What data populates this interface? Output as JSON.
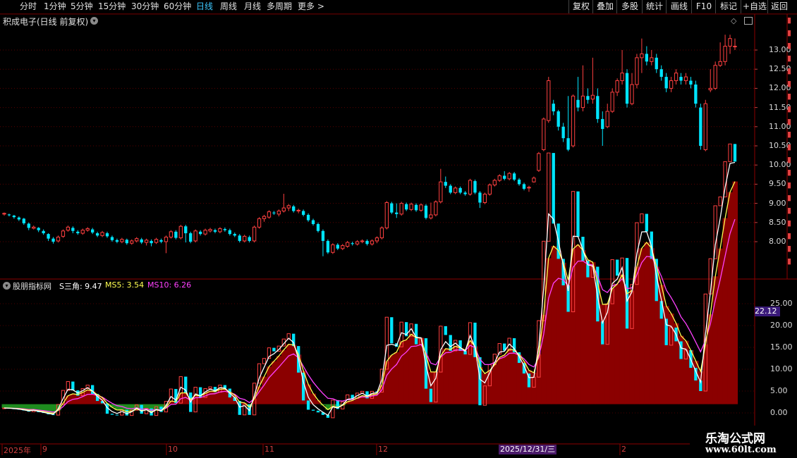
{
  "toolbar": {
    "left": [
      "分时",
      "1分钟",
      "5分钟",
      "15分钟",
      "30分钟",
      "60分钟",
      "日线",
      "周线",
      "月线",
      "多周期",
      "更多 >"
    ],
    "active": "日线",
    "right": [
      "复权",
      "叠加",
      "多股",
      "统计",
      "画线",
      "F10",
      "标记",
      "+自选",
      "返回"
    ]
  },
  "main": {
    "title": "积成电子(日线 前复权)",
    "y_labels": [
      "13.00",
      "12.50",
      "12.00",
      "11.50",
      "11.00",
      "10.50",
      "10.00",
      "9.50",
      "9.00",
      "8.50",
      "8.00"
    ]
  },
  "indicator": {
    "name": "股朋指标网",
    "s_label": "S三角: 9.47",
    "ms5_label": "MS5: 3.54",
    "ms10_label": "MS10: 6.26",
    "current_value": "22.12",
    "y_labels": [
      "25.00",
      "20.00",
      "15.00",
      "10.00",
      "5.00",
      "0.00"
    ]
  },
  "x_axis": {
    "labels": [
      "2025年",
      "9",
      "10",
      "11",
      "12",
      "2"
    ],
    "cursor_date": "2025/12/31/三"
  },
  "watermark": {
    "line1": "乐淘公式网",
    "line2": "www.60lt.com"
  },
  "colors": {
    "up": "#ff4040",
    "down": "#00e5ff",
    "area_red": "#8b0000",
    "area_green": "#1e8c1e",
    "ms5": "#ffff50",
    "ms10": "#ff40ff",
    "s": "#ffffff"
  },
  "chart_data": [
    {
      "type": "candlestick",
      "title": "积成电子(日线 前复权)",
      "ylim": [
        7.6,
        13.4
      ],
      "candles": [
        [
          8.72,
          8.74,
          8.68,
          8.76
        ],
        [
          8.71,
          8.69,
          8.66,
          8.73
        ],
        [
          8.68,
          8.64,
          8.6,
          8.7
        ],
        [
          8.63,
          8.58,
          8.54,
          8.66
        ],
        [
          8.6,
          8.48,
          8.44,
          8.62
        ],
        [
          8.47,
          8.36,
          8.3,
          8.5
        ],
        [
          8.35,
          8.38,
          8.32,
          8.42
        ],
        [
          8.36,
          8.3,
          8.25,
          8.38
        ],
        [
          8.28,
          8.22,
          8.18,
          8.32
        ],
        [
          8.2,
          8.08,
          8.02,
          8.22
        ],
        [
          8.08,
          8.0,
          7.95,
          8.12
        ],
        [
          8.02,
          8.12,
          7.98,
          8.16
        ],
        [
          8.14,
          8.28,
          8.1,
          8.32
        ],
        [
          8.3,
          8.38,
          8.26,
          8.42
        ],
        [
          8.36,
          8.28,
          8.22,
          8.4
        ],
        [
          8.26,
          8.22,
          8.18,
          8.3
        ],
        [
          8.22,
          8.3,
          8.18,
          8.34
        ],
        [
          8.3,
          8.34,
          8.26,
          8.38
        ],
        [
          8.32,
          8.24,
          8.2,
          8.36
        ],
        [
          8.22,
          8.16,
          8.12,
          8.26
        ],
        [
          8.16,
          8.24,
          8.12,
          8.28
        ],
        [
          8.22,
          8.14,
          8.1,
          8.26
        ],
        [
          8.12,
          8.04,
          8.0,
          8.16
        ],
        [
          8.04,
          8.0,
          7.96,
          8.08
        ],
        [
          8.0,
          8.06,
          7.96,
          8.1
        ],
        [
          8.05,
          7.96,
          7.92,
          8.08
        ],
        [
          7.96,
          8.02,
          7.92,
          8.06
        ],
        [
          8.02,
          8.08,
          7.98,
          8.12
        ],
        [
          8.06,
          7.98,
          7.94,
          8.1
        ],
        [
          7.98,
          8.04,
          7.9,
          8.08
        ],
        [
          8.02,
          7.96,
          7.88,
          8.06
        ],
        [
          7.98,
          8.06,
          7.94,
          8.1
        ],
        [
          8.04,
          8.0,
          7.96,
          8.08
        ],
        [
          8.0,
          8.12,
          7.7,
          8.16
        ],
        [
          8.12,
          8.26,
          8.08,
          8.3
        ],
        [
          8.26,
          8.1,
          8.06,
          8.3
        ],
        [
          8.1,
          8.4,
          8.06,
          8.44
        ],
        [
          8.4,
          8.22,
          7.98,
          8.44
        ],
        [
          8.22,
          8.0,
          7.96,
          8.26
        ],
        [
          8.02,
          8.28,
          7.98,
          8.32
        ],
        [
          8.26,
          8.2,
          8.16,
          8.3
        ],
        [
          8.2,
          8.3,
          8.16,
          8.34
        ],
        [
          8.28,
          8.32,
          8.24,
          8.36
        ],
        [
          8.3,
          8.26,
          8.22,
          8.34
        ],
        [
          8.26,
          8.34,
          8.22,
          8.38
        ],
        [
          8.33,
          8.3,
          8.26,
          8.37
        ],
        [
          8.3,
          8.2,
          8.16,
          8.34
        ],
        [
          8.2,
          8.16,
          8.12,
          8.24
        ],
        [
          8.16,
          8.02,
          7.98,
          8.2
        ],
        [
          8.02,
          8.14,
          7.98,
          8.18
        ],
        [
          8.12,
          8.02,
          7.98,
          8.16
        ],
        [
          8.02,
          8.38,
          7.98,
          8.42
        ],
        [
          8.38,
          8.6,
          8.34,
          8.64
        ],
        [
          8.6,
          8.66,
          8.52,
          8.7
        ],
        [
          8.64,
          8.78,
          8.6,
          8.82
        ],
        [
          8.76,
          8.74,
          8.7,
          8.8
        ],
        [
          8.72,
          8.8,
          8.66,
          8.84
        ],
        [
          8.8,
          8.88,
          8.76,
          9.25
        ],
        [
          8.88,
          8.94,
          8.8,
          8.98
        ],
        [
          8.92,
          8.8,
          8.76,
          8.96
        ],
        [
          8.8,
          8.82,
          8.74,
          8.86
        ],
        [
          8.8,
          8.7,
          8.66,
          8.84
        ],
        [
          8.7,
          8.56,
          8.52,
          8.74
        ],
        [
          8.56,
          8.46,
          8.42,
          8.6
        ],
        [
          8.46,
          8.28,
          8.24,
          8.5
        ],
        [
          8.28,
          8.02,
          7.62,
          8.32
        ],
        [
          8.02,
          7.72,
          7.68,
          8.06
        ],
        [
          7.72,
          7.92,
          7.68,
          7.96
        ],
        [
          7.92,
          7.82,
          7.78,
          7.96
        ],
        [
          7.82,
          7.9,
          7.78,
          7.94
        ],
        [
          7.88,
          7.98,
          7.84,
          8.02
        ],
        [
          7.96,
          7.94,
          7.9,
          8.0
        ],
        [
          7.94,
          8.0,
          7.9,
          8.04
        ],
        [
          8.0,
          8.02,
          7.96,
          8.06
        ],
        [
          8.02,
          7.94,
          7.9,
          8.06
        ],
        [
          7.94,
          8.02,
          7.9,
          8.06
        ],
        [
          8.02,
          8.1,
          7.96,
          8.14
        ],
        [
          8.1,
          8.36,
          8.06,
          8.4
        ],
        [
          8.36,
          9.02,
          8.32,
          9.06
        ],
        [
          9.0,
          8.76,
          8.72,
          9.04
        ],
        [
          8.76,
          8.72,
          8.62,
          9.0
        ],
        [
          8.72,
          9.0,
          8.68,
          9.04
        ],
        [
          8.98,
          8.84,
          8.8,
          9.02
        ],
        [
          8.84,
          8.98,
          8.8,
          9.02
        ],
        [
          8.96,
          8.82,
          8.78,
          9.0
        ],
        [
          8.82,
          8.96,
          8.78,
          9.0
        ],
        [
          8.94,
          8.62,
          8.58,
          8.98
        ],
        [
          8.62,
          8.7,
          8.58,
          9.02
        ],
        [
          8.7,
          9.04,
          8.66,
          9.08
        ],
        [
          9.04,
          9.56,
          9.0,
          9.9
        ],
        [
          9.56,
          9.46,
          9.4,
          9.7
        ],
        [
          9.46,
          9.28,
          9.24,
          9.5
        ],
        [
          9.28,
          9.4,
          9.24,
          9.44
        ],
        [
          9.4,
          9.28,
          9.24,
          9.44
        ],
        [
          9.28,
          9.24,
          9.2,
          9.32
        ],
        [
          9.24,
          9.6,
          9.2,
          9.64
        ],
        [
          9.58,
          9.28,
          9.24,
          9.62
        ],
        [
          9.28,
          9.02,
          8.88,
          9.32
        ],
        [
          9.02,
          9.24,
          8.98,
          9.28
        ],
        [
          9.24,
          9.48,
          9.2,
          9.52
        ],
        [
          9.48,
          9.6,
          9.44,
          9.64
        ],
        [
          9.6,
          9.72,
          9.56,
          9.76
        ],
        [
          9.72,
          9.64,
          9.6,
          9.84
        ],
        [
          9.64,
          9.78,
          9.6,
          9.82
        ],
        [
          9.78,
          9.62,
          9.58,
          9.82
        ],
        [
          9.62,
          9.5,
          9.46,
          9.66
        ],
        [
          9.5,
          9.38,
          9.34,
          9.54
        ],
        [
          9.4,
          9.42,
          9.3,
          9.46
        ],
        [
          9.56,
          9.66,
          9.54,
          9.7
        ],
        [
          9.86,
          10.3,
          9.82,
          10.34
        ],
        [
          10.4,
          11.2,
          10.36,
          11.24
        ],
        [
          11.16,
          12.2,
          11.1,
          12.3
        ],
        [
          11.6,
          11.4,
          11.3,
          11.7
        ],
        [
          11.4,
          11.0,
          10.9,
          11.44
        ],
        [
          11.0,
          10.7,
          10.6,
          11.1
        ],
        [
          10.7,
          10.4,
          10.36,
          11.8
        ],
        [
          10.5,
          11.8,
          10.46,
          11.84
        ],
        [
          11.7,
          11.5,
          11.4,
          12.3
        ],
        [
          11.5,
          11.8,
          11.4,
          12.6
        ],
        [
          11.8,
          11.7,
          11.6,
          12.0
        ],
        [
          11.72,
          11.82,
          11.6,
          12.8
        ],
        [
          11.8,
          11.2,
          11.1,
          12.0
        ],
        [
          11.2,
          10.94,
          10.5,
          11.4
        ],
        [
          11.0,
          11.4,
          10.96,
          11.6
        ],
        [
          11.4,
          11.9,
          11.36,
          12.0
        ],
        [
          11.9,
          12.2,
          11.8,
          12.26
        ],
        [
          12.2,
          12.4,
          12.1,
          13.0
        ],
        [
          12.4,
          11.6,
          11.5,
          12.5
        ],
        [
          11.6,
          12.1,
          11.56,
          12.4
        ],
        [
          12.1,
          12.8,
          12.0,
          12.9
        ],
        [
          12.8,
          12.9,
          12.4,
          13.3
        ],
        [
          12.9,
          12.7,
          12.6,
          13.1
        ],
        [
          12.7,
          12.8,
          12.6,
          13.0
        ],
        [
          12.8,
          12.5,
          12.4,
          12.9
        ],
        [
          12.5,
          12.3,
          12.2,
          12.6
        ],
        [
          12.3,
          12.0,
          11.9,
          12.4
        ],
        [
          12.0,
          12.2,
          11.9,
          12.3
        ],
        [
          12.2,
          12.4,
          12.1,
          12.5
        ],
        [
          12.3,
          12.2,
          12.1,
          12.4
        ],
        [
          12.2,
          12.3,
          12.1,
          12.4
        ],
        [
          12.2,
          12.1,
          12.0,
          12.3
        ],
        [
          12.1,
          11.6,
          11.5,
          12.2
        ],
        [
          11.5,
          10.5,
          10.4,
          11.6
        ],
        [
          10.4,
          11.6,
          10.36,
          11.7
        ],
        [
          11.96,
          12.0,
          11.9,
          12.5
        ],
        [
          12.0,
          12.6,
          11.96,
          12.7
        ],
        [
          12.6,
          12.7,
          12.56,
          13.2
        ],
        [
          12.7,
          13.1,
          12.6,
          13.4
        ],
        [
          13.1,
          13.3,
          12.9,
          13.4
        ],
        [
          13.1,
          13.1,
          13.0,
          13.3
        ]
      ]
    },
    {
      "type": "bar+line",
      "title": "股朋指标网",
      "ylim": [
        -2,
        27
      ],
      "series": [
        {
          "name": "S三角",
          "values": [
            9.47
          ]
        },
        {
          "name": "MS5",
          "values": [
            3.54
          ]
        },
        {
          "name": "MS10",
          "values": [
            6.26
          ]
        }
      ],
      "current_value": 22.12
    }
  ]
}
